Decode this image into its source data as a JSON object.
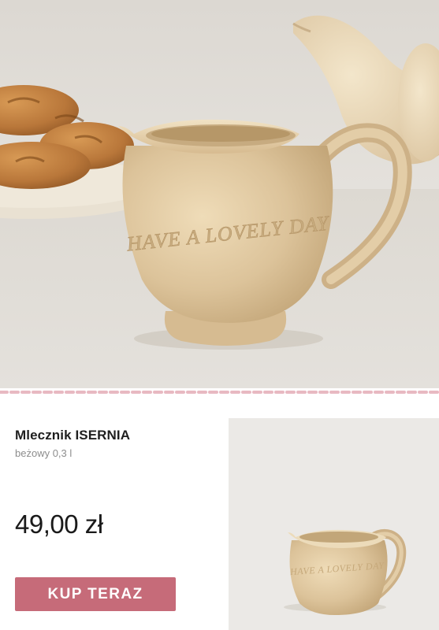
{
  "hero": {
    "jug_text": "HAVE A LOVELY DAY",
    "colors": {
      "cream": "#dcc39a",
      "cloth": "#ddd9d2",
      "wall": "#e7e4df",
      "croissant": "#b9773a"
    }
  },
  "product": {
    "name": "Mlecznik ISERNIA",
    "variant": "beżowy 0,3 l",
    "price": "49,00 zł",
    "buy_label": "KUP TERAZ"
  },
  "thumbnail": {
    "jug_text": "HAVE A LOVELY DAY"
  },
  "colors": {
    "accent": "#c66b79",
    "divider": "#e8b9c2"
  }
}
